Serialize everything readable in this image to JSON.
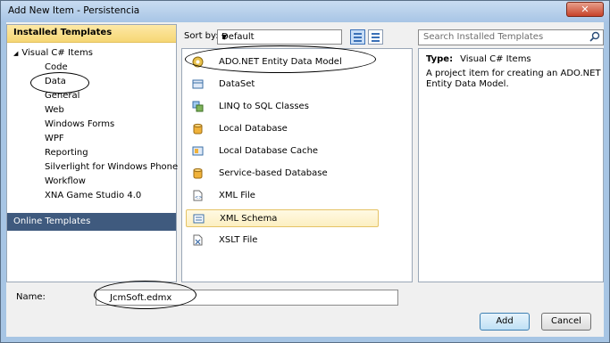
{
  "window": {
    "title": "Add New Item - Persistencia",
    "close_glyph": "✕"
  },
  "left": {
    "installed_label": "Installed Templates",
    "root_label": "Visual C# Items",
    "items": [
      {
        "label": "Code"
      },
      {
        "label": "Data"
      },
      {
        "label": "General"
      },
      {
        "label": "Web"
      },
      {
        "label": "Windows Forms"
      },
      {
        "label": "WPF"
      },
      {
        "label": "Reporting"
      },
      {
        "label": "Silverlight for Windows Phone"
      },
      {
        "label": "Workflow"
      },
      {
        "label": "XNA Game Studio 4.0"
      }
    ],
    "online_label": "Online Templates"
  },
  "sort": {
    "label": "Sort by:",
    "value": "Default"
  },
  "search": {
    "placeholder": "Search Installed Templates",
    "icon": "search-icon"
  },
  "templates": [
    {
      "label": "ADO.NET Entity Data Model",
      "icon": "entity-model-icon"
    },
    {
      "label": "DataSet",
      "icon": "dataset-icon"
    },
    {
      "label": "LINQ to SQL Classes",
      "icon": "linq-icon"
    },
    {
      "label": "Local Database",
      "icon": "database-icon"
    },
    {
      "label": "Local Database Cache",
      "icon": "database-cache-icon"
    },
    {
      "label": "Service-based Database",
      "icon": "database-icon"
    },
    {
      "label": "XML File",
      "icon": "xml-file-icon"
    },
    {
      "label": "XML Schema",
      "icon": "xml-schema-icon"
    },
    {
      "label": "XSLT File",
      "icon": "xslt-file-icon"
    }
  ],
  "description": {
    "type_label": "Type:",
    "type_value": "Visual C# Items",
    "text": "A project item for creating an ADO.NET Entity Data Model."
  },
  "name_field": {
    "label": "Name:",
    "value": "JcmSoft.edmx"
  },
  "buttons": {
    "add": "Add",
    "cancel": "Cancel"
  },
  "colors": {
    "online_bg": "#3f5a7e",
    "header_bg": "#fde8a6",
    "selection_border": "#e5c365"
  }
}
